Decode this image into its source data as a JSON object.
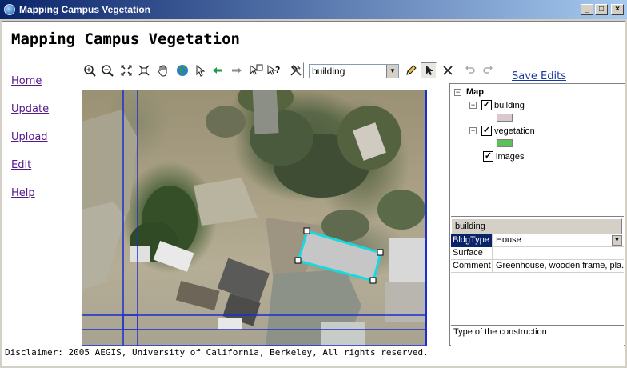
{
  "window": {
    "title": "Mapping Campus Vegetation",
    "controls": [
      "_",
      "□",
      "×"
    ]
  },
  "page_title": "Mapping Campus Vegetation",
  "nav": [
    {
      "label": "Home"
    },
    {
      "label": "Update"
    },
    {
      "label": "Upload"
    },
    {
      "label": "Edit"
    },
    {
      "label": "Help"
    }
  ],
  "toolbar": {
    "layer_select_value": "building",
    "save_label": "Save Edits",
    "icons": [
      "zoom-in-icon",
      "zoom-out-icon",
      "zoom-full-icon",
      "zoom-extent-icon",
      "pan-hand-icon",
      "globe-icon",
      "select-arrow-icon",
      "back-arrow-icon",
      "forward-arrow-icon",
      "identify-icon",
      "query-icon",
      "edit-tools-icon",
      "pencil-icon",
      "select-feature-icon",
      "delete-icon",
      "undo-icon",
      "redo-icon"
    ]
  },
  "layers": {
    "root": "Map",
    "items": [
      {
        "label": "building",
        "checked": true,
        "color": "#d8c8d0"
      },
      {
        "label": "vegetation",
        "checked": true,
        "color": "#5cc05c"
      },
      {
        "label": "images",
        "checked": true
      }
    ]
  },
  "properties": {
    "header": "building",
    "rows": [
      {
        "key": "BldgType",
        "value": "House"
      },
      {
        "key": "Surface",
        "value": ""
      },
      {
        "key": "Comment",
        "value": "Greenhouse, wooden frame, pla..."
      }
    ],
    "help_text": "Type of the construction"
  },
  "disclaimer": "Disclaimer: 2005 AEGIS, University of California, Berkeley, All rights reserved.",
  "colors": {
    "titlebar": "#0a246a",
    "grid_lines": "#1a2fd0",
    "selection": "#19d8e0"
  }
}
